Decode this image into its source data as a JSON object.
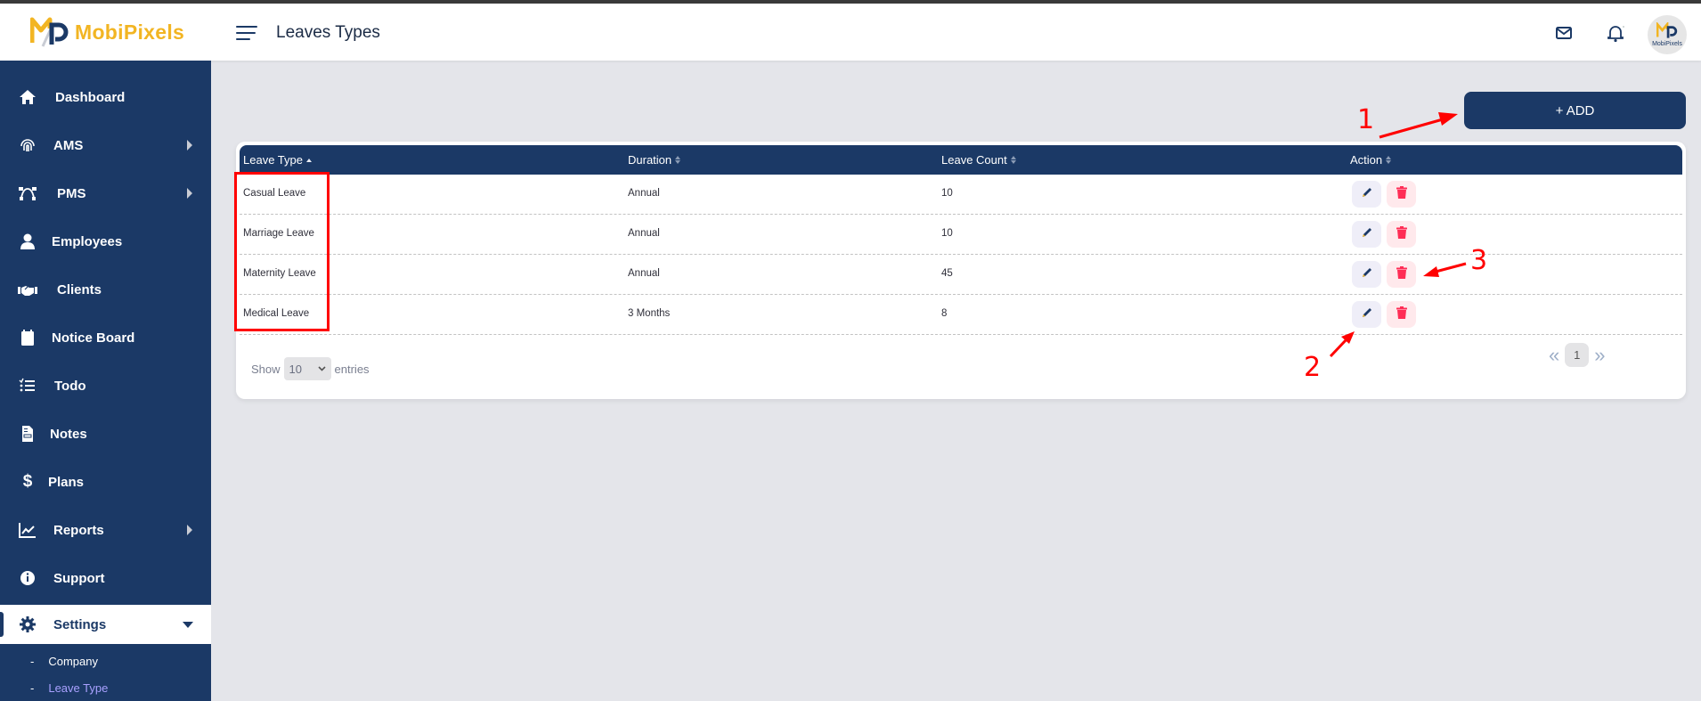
{
  "header": {
    "brand": "MobiPixels",
    "page_title": "Leaves Types",
    "avatar_text": "MobiPixels",
    "icons": [
      "menu-icon",
      "mail-icon",
      "bell-icon"
    ]
  },
  "sidebar": {
    "items": [
      {
        "label": "Dashboard",
        "icon": "home-icon",
        "has_submenu": false
      },
      {
        "label": "AMS",
        "icon": "fingerprint-icon",
        "has_submenu": true
      },
      {
        "label": "PMS",
        "icon": "bezier-icon",
        "has_submenu": true
      },
      {
        "label": "Employees",
        "icon": "user-icon",
        "has_submenu": false
      },
      {
        "label": "Clients",
        "icon": "handshake-icon",
        "has_submenu": false
      },
      {
        "label": "Notice Board",
        "icon": "calendar-icon",
        "has_submenu": false
      },
      {
        "label": "Todo",
        "icon": "checklist-icon",
        "has_submenu": false
      },
      {
        "label": "Notes",
        "icon": "note-icon",
        "has_submenu": false
      },
      {
        "label": "Plans",
        "icon": "dollar-icon",
        "has_submenu": false
      },
      {
        "label": "Reports",
        "icon": "chart-icon",
        "has_submenu": true
      },
      {
        "label": "Support",
        "icon": "info-icon",
        "has_submenu": false
      },
      {
        "label": "Settings",
        "icon": "gear-icon",
        "has_submenu": true,
        "expanded": true,
        "active": true
      }
    ],
    "settings_submenu": [
      {
        "label": "Company",
        "bullet": "-"
      },
      {
        "label": "Leave Type",
        "bullet": "-",
        "current": true
      }
    ]
  },
  "toolbar": {
    "add_label": "+ ADD"
  },
  "table": {
    "columns": [
      {
        "label": "Leave Type",
        "sort": "asc"
      },
      {
        "label": "Duration",
        "sort": "none"
      },
      {
        "label": "Leave Count",
        "sort": "none"
      },
      {
        "label": "Action",
        "sort": "none"
      }
    ],
    "rows": [
      {
        "leave_type": "Casual Leave",
        "duration": "Annual",
        "leave_count": "10"
      },
      {
        "leave_type": "Marriage Leave",
        "duration": "Annual",
        "leave_count": "10"
      },
      {
        "leave_type": "Maternity Leave",
        "duration": "Annual",
        "leave_count": "45"
      },
      {
        "leave_type": "Medical Leave",
        "duration": "3 Months",
        "leave_count": "8"
      }
    ]
  },
  "footer": {
    "show_label": "Show",
    "entries_value": "10",
    "entries_label": "entries",
    "pagination": {
      "prev": "«",
      "current_page": "1",
      "next": "»"
    }
  },
  "annotations": {
    "labels": [
      "1",
      "2",
      "3"
    ],
    "color": "#ff0000"
  },
  "colors": {
    "primary": "#1b3966",
    "brand_yellow": "#f2b523",
    "delete_red": "#ff2d55",
    "background": "#e4e5ea"
  }
}
